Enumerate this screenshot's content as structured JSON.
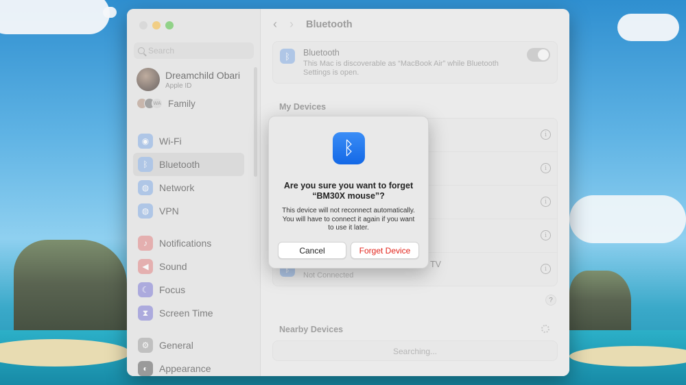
{
  "window": {
    "title": "Bluetooth"
  },
  "sidebar": {
    "search_placeholder": "Search",
    "user": {
      "name": "Dreamchild Obari",
      "subtitle": "Apple ID"
    },
    "family_label": "Family",
    "family_badge": "WA",
    "items": [
      {
        "label": "Wi-Fi",
        "icon": "wifi-icon",
        "glyph": "◉",
        "color": "#8fb2e3"
      },
      {
        "label": "Bluetooth",
        "icon": "bluetooth-icon",
        "glyph": "ᛒ",
        "color": "#8fb2e3",
        "selected": true
      },
      {
        "label": "Network",
        "icon": "network-globe-icon",
        "glyph": "◍",
        "color": "#8fb2e3"
      },
      {
        "label": "VPN",
        "icon": "vpn-globe-icon",
        "glyph": "◍",
        "color": "#8fb2e3"
      },
      {
        "label": "Notifications",
        "icon": "notifications-bell-icon",
        "glyph": "♪",
        "color": "#e08f8f"
      },
      {
        "label": "Sound",
        "icon": "sound-speaker-icon",
        "glyph": "◀",
        "color": "#e08f8f"
      },
      {
        "label": "Focus",
        "icon": "focus-moon-icon",
        "glyph": "☾",
        "color": "#8a88d6"
      },
      {
        "label": "Screen Time",
        "icon": "screen-time-hourglass-icon",
        "glyph": "⧗",
        "color": "#8a88d6"
      },
      {
        "label": "General",
        "icon": "general-gear-icon",
        "glyph": "⚙",
        "color": "#a9a9a9"
      },
      {
        "label": "Appearance",
        "icon": "appearance-circle-icon",
        "glyph": "◐",
        "color": "#6f6f6f"
      }
    ]
  },
  "main": {
    "bluetooth_card": {
      "title": "Bluetooth",
      "description": "This Mac is discoverable as “MacBook Air” while Bluetooth Settings is open.",
      "enabled": true
    },
    "my_devices_label": "My Devices",
    "devices": [
      {
        "name": "",
        "status": ""
      },
      {
        "name": "",
        "status": ""
      },
      {
        "name": "",
        "status": ""
      },
      {
        "name": "",
        "status": ""
      },
      {
        "name": "TV",
        "status": "Not Connected"
      }
    ],
    "help_label": "?",
    "nearby_label": "Nearby Devices",
    "nearby_status": "Searching..."
  },
  "dialog": {
    "icon": "bluetooth-icon",
    "title": "Are you sure you want to forget “BM30X mouse”?",
    "message": "This device will not reconnect automatically. You will have to connect it again if you want to use it later.",
    "cancel_label": "Cancel",
    "confirm_label": "Forget Device",
    "confirm_color": "#e2231a"
  }
}
